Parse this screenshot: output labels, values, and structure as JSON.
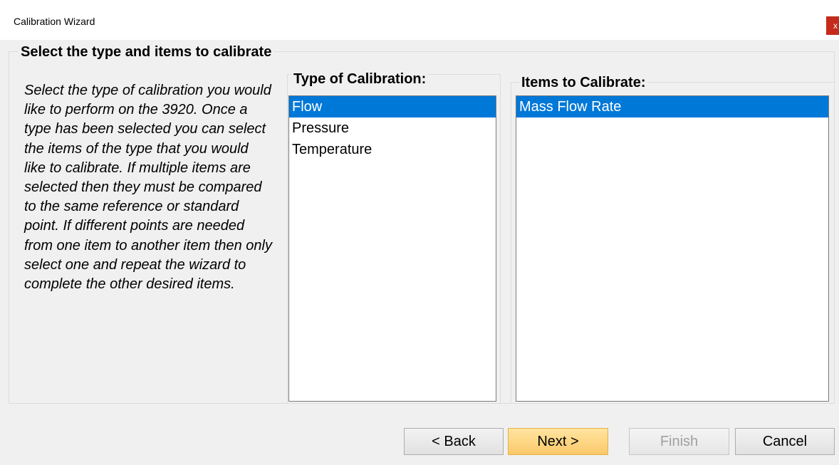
{
  "window": {
    "title": "Calibration Wizard",
    "close_glyph": "x"
  },
  "group": {
    "title": "Select the type and items to calibrate",
    "instructions": "Select the type of calibration you would like to perform on the 3920.  Once a type has been selected you can select the items of the type that you would like to calibrate.   If multiple items are selected then they must be compared to the same reference or standard point.  If different points are needed from one item to another item then only select one and repeat the wizard to complete the other desired items."
  },
  "type_panel": {
    "title": "Type of Calibration:",
    "items": [
      {
        "label": "Flow",
        "selected": true
      },
      {
        "label": "Pressure",
        "selected": false
      },
      {
        "label": "Temperature",
        "selected": false
      }
    ]
  },
  "items_panel": {
    "title": "Items to Calibrate:",
    "items": [
      {
        "label": "Mass Flow Rate",
        "selected": true
      }
    ]
  },
  "buttons": {
    "back": "< Back",
    "next": "Next >",
    "finish": "Finish",
    "cancel": "Cancel"
  },
  "colors": {
    "selection": "#0078d7",
    "default_button": "#fbc86a",
    "close_button": "#c42b1c"
  }
}
